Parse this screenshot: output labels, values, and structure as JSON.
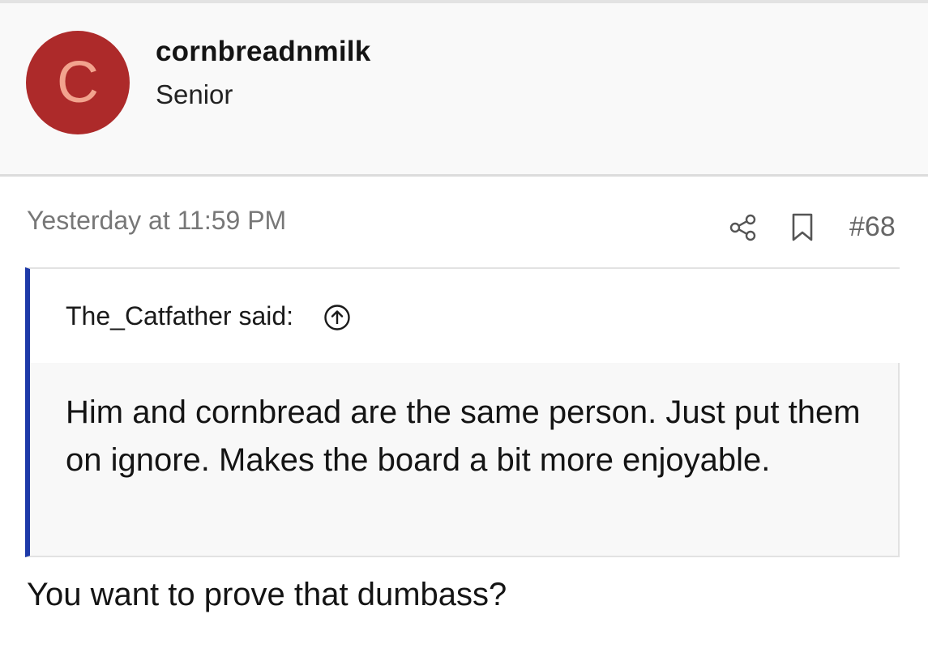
{
  "post": {
    "author": {
      "avatar_letter": "C",
      "avatar_color": "#ad2a2a",
      "avatar_letter_color": "#f2a38e",
      "username": "cornbreadnmilk",
      "title": "Senior"
    },
    "timestamp": "Yesterday at 11:59 PM",
    "actions": {
      "share_icon": "share-icon",
      "bookmark_icon": "bookmark-icon",
      "post_number": "#68"
    },
    "quote": {
      "author": "The_Catfather",
      "said_suffix": " said:",
      "jump_icon": "arrow-up-circle-icon",
      "accent_color": "#1e3aa8",
      "body": "Him and cornbread are the same person. Just put them on ignore. Makes the board a bit more enjoyable."
    },
    "reply": "You want to prove that dumbass?"
  }
}
